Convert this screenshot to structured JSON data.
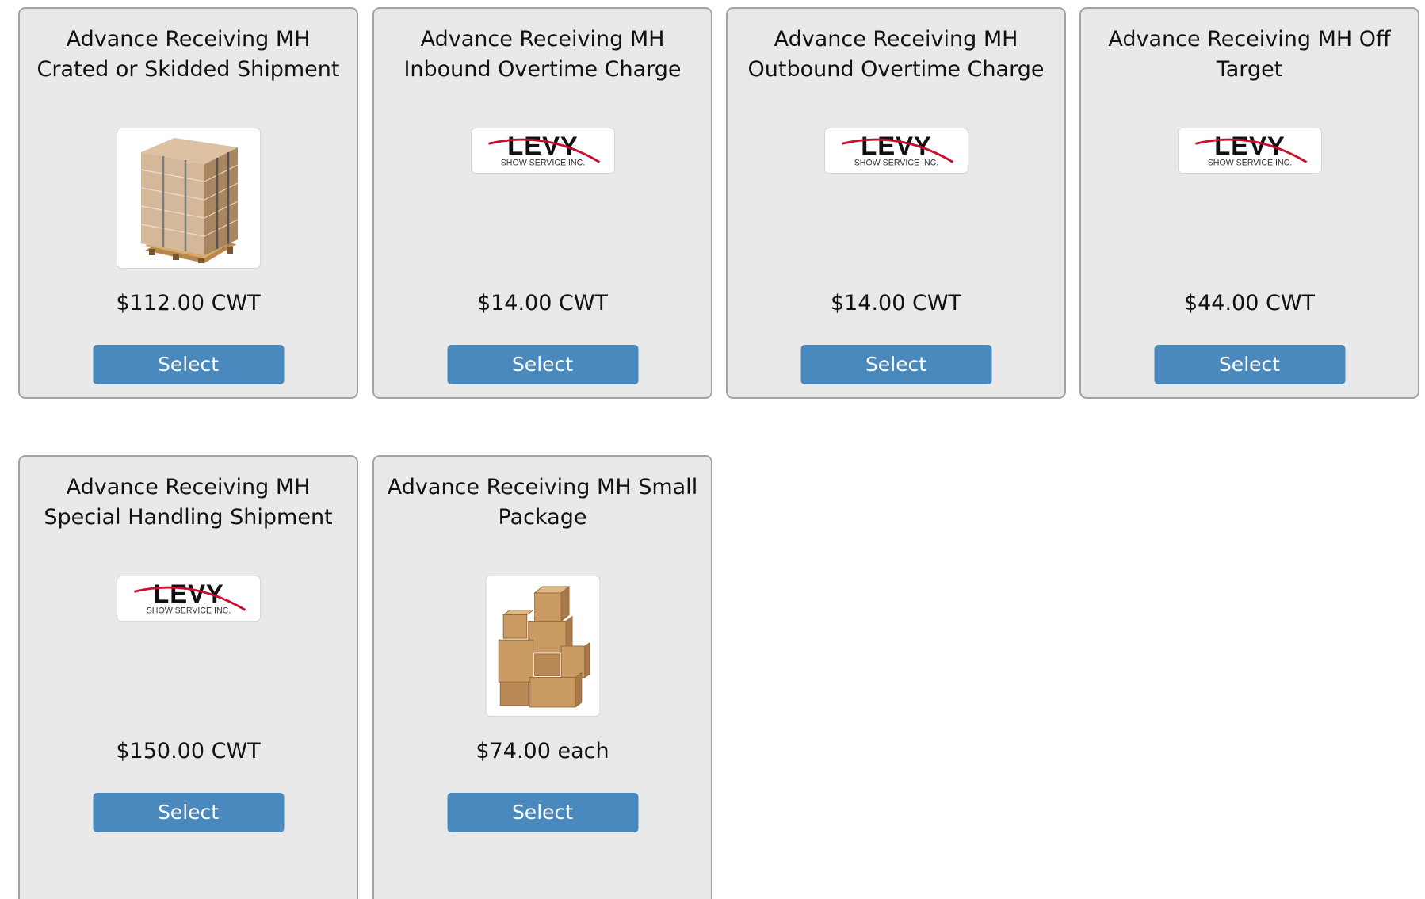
{
  "products": [
    {
      "title": "Advance Receiving MH Crated or Skidded Shipment",
      "image": "pallet-photo",
      "price": "$112.00 CWT",
      "button_label": "Select"
    },
    {
      "title": "Advance Receiving MH Inbound Overtime Charge",
      "image": "levy-logo",
      "logo_text": "LEVY",
      "logo_subtext": "SHOW SERVICE INC.",
      "price": "$14.00 CWT",
      "button_label": "Select"
    },
    {
      "title": "Advance Receiving MH Outbound Overtime Charge",
      "image": "levy-logo",
      "logo_text": "LEVY",
      "logo_subtext": "SHOW SERVICE INC.",
      "price": "$14.00 CWT",
      "button_label": "Select"
    },
    {
      "title": "Advance Receiving MH Off Target",
      "image": "levy-logo",
      "logo_text": "LEVY",
      "logo_subtext": "SHOW SERVICE INC.",
      "price": "$44.00 CWT",
      "button_label": "Select"
    },
    {
      "title": "Advance Receiving MH Special Handling Shipment",
      "image": "levy-logo",
      "logo_text": "LEVY",
      "logo_subtext": "SHOW SERVICE INC.",
      "price": "$150.00 CWT",
      "button_label": "Select"
    },
    {
      "title": "Advance Receiving MH Small Package",
      "image": "boxes-photo",
      "price": "$74.00 each",
      "button_label": "Select"
    }
  ],
  "colors": {
    "card_background": "#e9e9e9",
    "card_border": "#a3a3a3",
    "button_background": "#4a89bd",
    "button_text": "#ffffff",
    "logo_accent": "#c8102e"
  }
}
